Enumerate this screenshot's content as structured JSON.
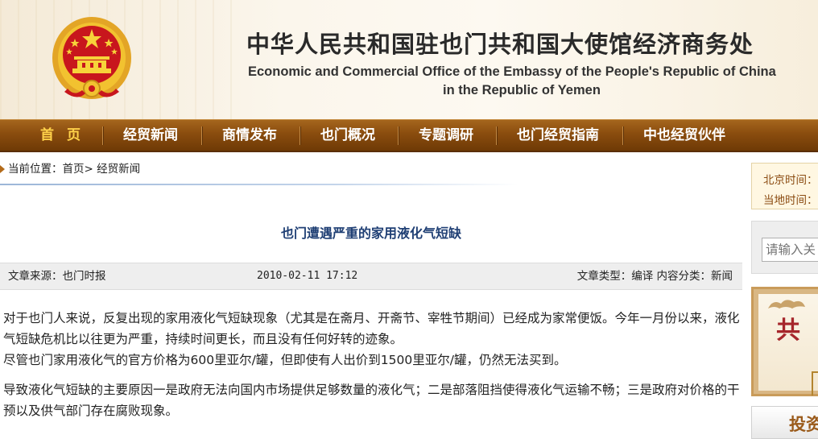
{
  "header": {
    "title_cn": "中华人民共和国驻也门共和国大使馆经济商务处",
    "title_en_line1": "Economic and Commercial Office of the Embassy of the People's Republic of China",
    "title_en_line2": "in the Republic of Yemen",
    "emblem": "national-emblem-icon"
  },
  "nav": {
    "items": [
      {
        "label": "首页",
        "active": true
      },
      {
        "label": "经贸新闻"
      },
      {
        "label": "商情发布"
      },
      {
        "label": "也门概况"
      },
      {
        "label": "专题调研"
      },
      {
        "label": "也门经贸指南"
      },
      {
        "label": "中也经贸伙伴"
      }
    ]
  },
  "breadcrumb": {
    "prefix": "当前位置：",
    "home": "首页",
    "sep": ">",
    "current": "经贸新闻"
  },
  "article": {
    "title": "也门遭遇严重的家用液化气短缺",
    "source": "文章来源：也门时报",
    "date": "2010-02-11 17:12",
    "type_info": "文章类型：编译 内容分类：新闻",
    "paragraphs": [
      "对于也门人来说，反复出现的家用液化气短缺现象（尤其是在斋月、开斋节、宰牲节期间）已经成为家常便饭。今年一月份以来，液化气短缺危机比以往更为严重，持续时间更长，而且没有任何好转的迹象。",
      "尽管也门家用液化气的官方价格为600里亚尔/罐，但即使有人出价到1500里亚尔/罐，仍然无法买到。",
      "导致液化气短缺的主要原因一是政府无法向国内市场提供足够数量的液化气；二是部落阻挡使得液化气运输不畅；三是政府对价格的干预以及供气部门存在腐败现象。"
    ]
  },
  "sidebar": {
    "beijing_time_label": "北京时间：",
    "local_time_label": "当地时间：",
    "search_placeholder": "请输入关",
    "banner1_char": "共",
    "banner2_text": "投资"
  },
  "colors": {
    "nav_bg": "#8a4c0e",
    "nav_active": "#ffd24a",
    "title_blue": "#1f3f74",
    "emblem_red": "#c8161d",
    "emblem_gold": "#f2c230"
  }
}
